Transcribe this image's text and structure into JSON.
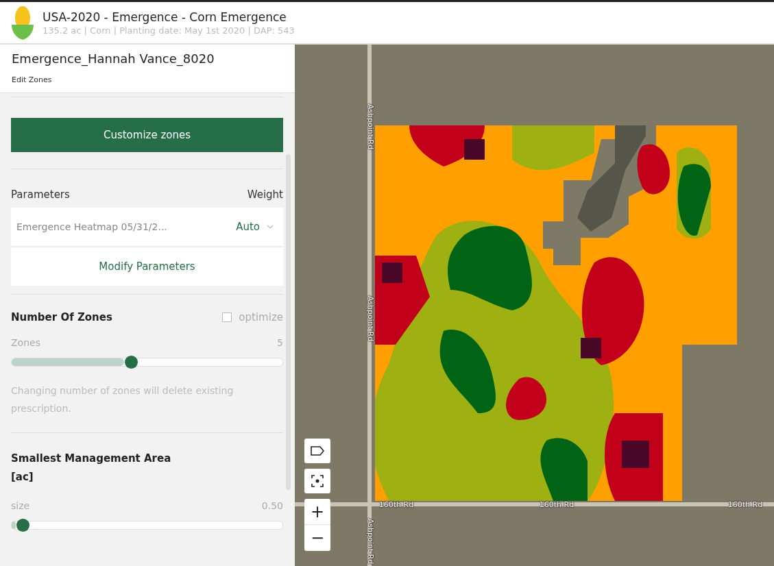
{
  "header": {
    "title": "USA-2020 - Emergence - Corn Emergence",
    "subtitle": "135.2 ac | Corn | Planting date: May 1st 2020 | DAP: 543"
  },
  "panel": {
    "title": "Emergence_Hannah Vance_8020",
    "subtitle": "Edit Zones",
    "primary_button": "Customize zones"
  },
  "parameters": {
    "label": "Parameters",
    "weight_label": "Weight",
    "rows": [
      {
        "name": "Emergence Heatmap 05/31/2...",
        "weight": "Auto"
      }
    ],
    "modify_button": "Modify Parameters"
  },
  "zones": {
    "title": "Number Of Zones",
    "optimize": {
      "label": "optimize",
      "checked": false
    },
    "slider_label": "Zones",
    "reading": "5",
    "level": 0.44,
    "warning": "Changing number of zones will delete existing prescription."
  },
  "area": {
    "title": "Smallest Management Area",
    "unit": "[ac]",
    "slider_label": "size",
    "reading": "0.50",
    "level": 0.04
  },
  "map": {
    "road_labels": [
      {
        "text": "Ashpoint Rd",
        "kind": "vertical"
      },
      {
        "text": "Ashpoint Rd",
        "kind": "vertical"
      },
      {
        "text": "Ashpoint Rd",
        "kind": "vertical"
      },
      {
        "text": "160th Rd",
        "kind": "horizontal"
      },
      {
        "text": "160th Rd",
        "kind": "horizontal"
      },
      {
        "text": "160th Rd",
        "kind": "horizontal"
      }
    ],
    "controls": [
      {
        "kind": "tag"
      },
      {
        "kind": "locate"
      }
    ],
    "zoom_in": "+",
    "zoom_out": "−"
  }
}
